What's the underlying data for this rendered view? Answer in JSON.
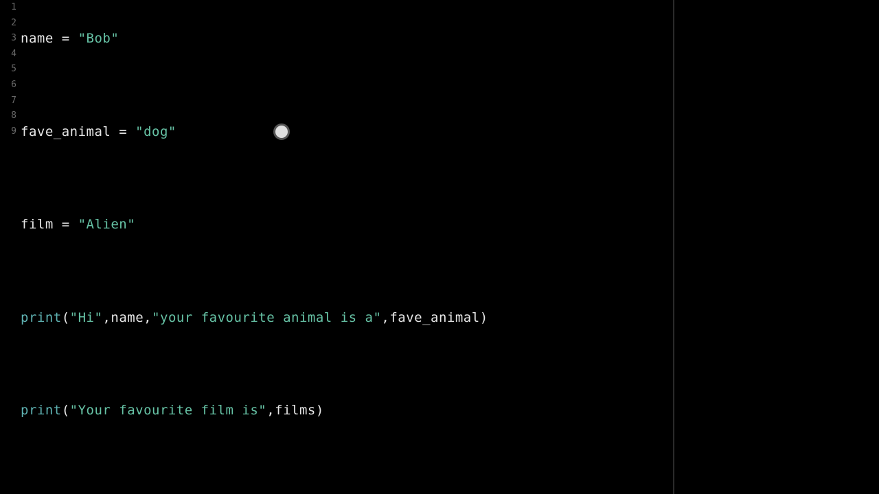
{
  "editor": {
    "lines": [
      {
        "n": "1"
      },
      {
        "n": "2"
      },
      {
        "n": "3"
      },
      {
        "n": "4"
      },
      {
        "n": "5"
      },
      {
        "n": "6"
      },
      {
        "n": "7"
      },
      {
        "n": "8"
      },
      {
        "n": "9"
      }
    ],
    "code": {
      "l1": {
        "var": "name",
        "eq": " = ",
        "str": "\"Bob\""
      },
      "l3": {
        "var": "fave_animal",
        "eq": " = ",
        "str": "\"dog\""
      },
      "l5": {
        "var": "film",
        "eq": " = ",
        "str": "\"Alien\""
      },
      "l7": {
        "fn": "print",
        "open": "(",
        "s1": "\"Hi\"",
        "c1": ",",
        "v1": "name",
        "c2": ",",
        "s2": "\"your favourite animal is a\"",
        "c3": ",",
        "v2": "fave_animal",
        "close": ")"
      },
      "l9": {
        "fn": "print",
        "open": "(",
        "s1": "\"Your favourite film is\"",
        "c1": ",",
        "v1": "films",
        "close": ")"
      }
    }
  }
}
